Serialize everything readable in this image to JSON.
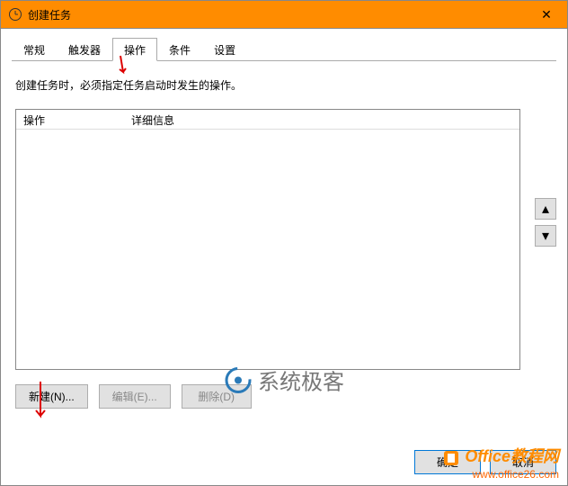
{
  "window": {
    "title": "创建任务",
    "close_symbol": "✕"
  },
  "tabs": [
    {
      "label": "常规"
    },
    {
      "label": "触发器"
    },
    {
      "label": "操作",
      "active": true
    },
    {
      "label": "条件"
    },
    {
      "label": "设置"
    }
  ],
  "instruction": "创建任务时，必须指定任务启动时发生的操作。",
  "list": {
    "headers": [
      "操作",
      "详细信息"
    ]
  },
  "side_buttons": {
    "up": "▴",
    "down": "▾"
  },
  "buttons": {
    "new": "新建(N)...",
    "edit": "编辑(E)...",
    "delete": "删除(D)"
  },
  "bottom": {
    "ok": "确定",
    "cancel": "取消"
  },
  "watermark": {
    "center": "系统极客",
    "brand": "Office教程网",
    "url": "www.office26.com"
  }
}
